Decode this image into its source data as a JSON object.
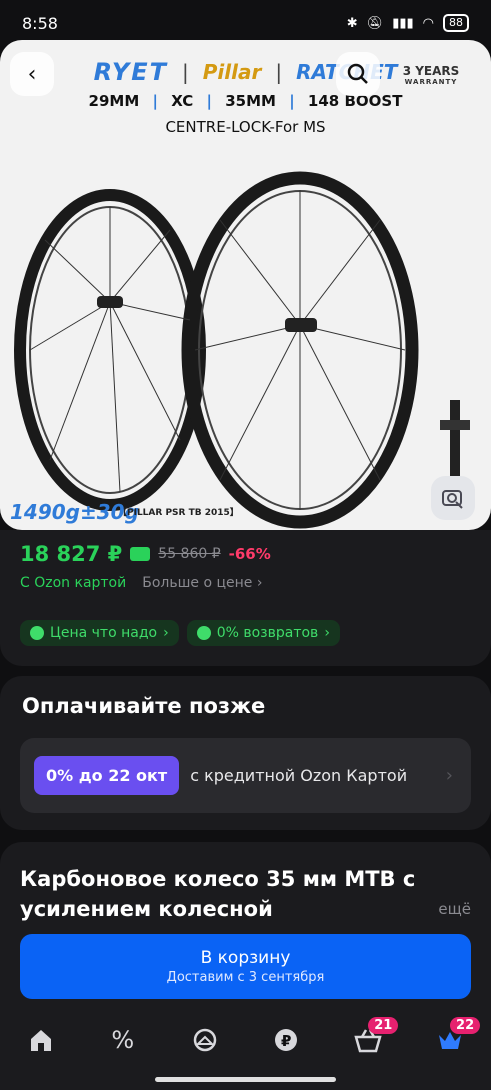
{
  "status": {
    "time": "8:58",
    "battery": "88"
  },
  "hero": {
    "brands": [
      "RYET",
      "Pillar",
      "RATCHET"
    ],
    "specs": [
      "29MM",
      "XC",
      "35MM",
      "148 BOOST"
    ],
    "subtitle": "CENTRE-LOCK-For MS",
    "warranty_line1": "3 YEARS",
    "warranty_line2": "WARRANTY",
    "weight": "1490g±30g",
    "weight_model": "【PILLAR PSR TB 2015】"
  },
  "price": {
    "current": "18 827 ₽",
    "old": "55 860 ₽",
    "discount": "-66%",
    "ozon_card": "С Ozon картой",
    "more": "Больше о цене",
    "chips": [
      "Цена что надо",
      "0% возвратов"
    ]
  },
  "pay_later": {
    "title": "Оплачивайте позже",
    "badge": "0% до 22 окт",
    "text": "с кредитной Ozon Картой"
  },
  "product": {
    "title": "Карбоновое колесо 35 мм MTB с усилением колесной",
    "more": "ещё",
    "cart_label": "В корзину",
    "cart_sub": "Доставим с 3 сентября"
  },
  "tabs": {
    "cart_count": "21",
    "profile_count": "22"
  },
  "colors": {
    "accent_blue": "#0a63f5",
    "green": "#2ad25a",
    "discount": "#ff3b6a",
    "badge_pink": "#e6216f"
  }
}
